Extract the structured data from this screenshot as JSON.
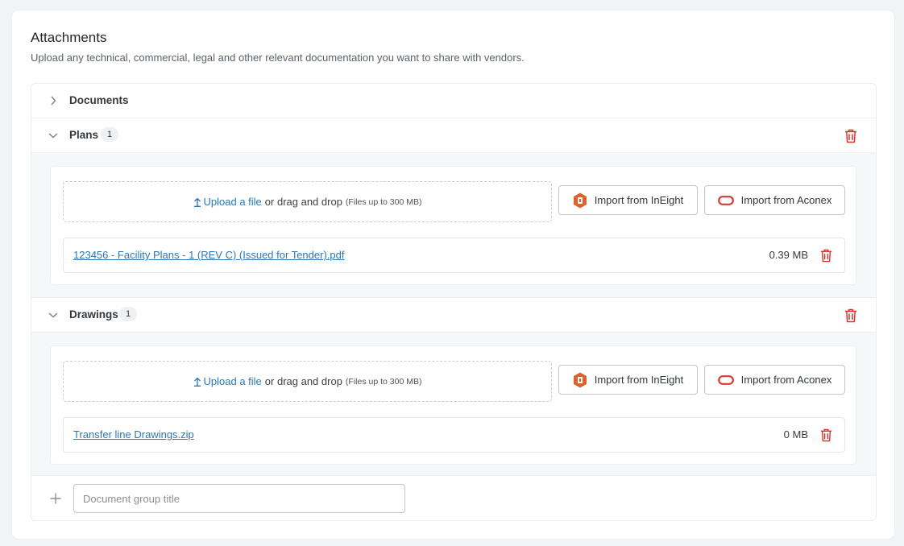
{
  "attachments": {
    "title": "Attachments",
    "subtitle": "Upload any technical, commercial, legal and other relevant documentation you want to share with vendors."
  },
  "colors": {
    "link": "#2b77b6",
    "danger": "#d9302c",
    "ineight": "#e0622a",
    "aconex": "#d63a35"
  },
  "groups": [
    {
      "label": "Documents",
      "expanded": false
    },
    {
      "label": "Plans",
      "count": "1",
      "expanded": true,
      "upload": {
        "link": "Upload a file",
        "text": "or drag and drop",
        "hint": "(Files up to 300 MB)"
      },
      "import_ineight": "Import from InEight",
      "import_aconex": "Import from Aconex",
      "file": {
        "name": "123456 - Facility Plans - 1 (REV C) (Issued for Tender).pdf",
        "size": "0.39 MB"
      }
    },
    {
      "label": "Drawings",
      "count": "1",
      "expanded": true,
      "upload": {
        "link": "Upload a file",
        "text": "or drag and drop",
        "hint": "(Files up to 300 MB)"
      },
      "import_ineight": "Import from InEight",
      "import_aconex": "Import from Aconex",
      "file": {
        "name": "Transfer line Drawings.zip",
        "size": "0 MB"
      }
    }
  ],
  "new_group": {
    "placeholder": "Document group title"
  }
}
